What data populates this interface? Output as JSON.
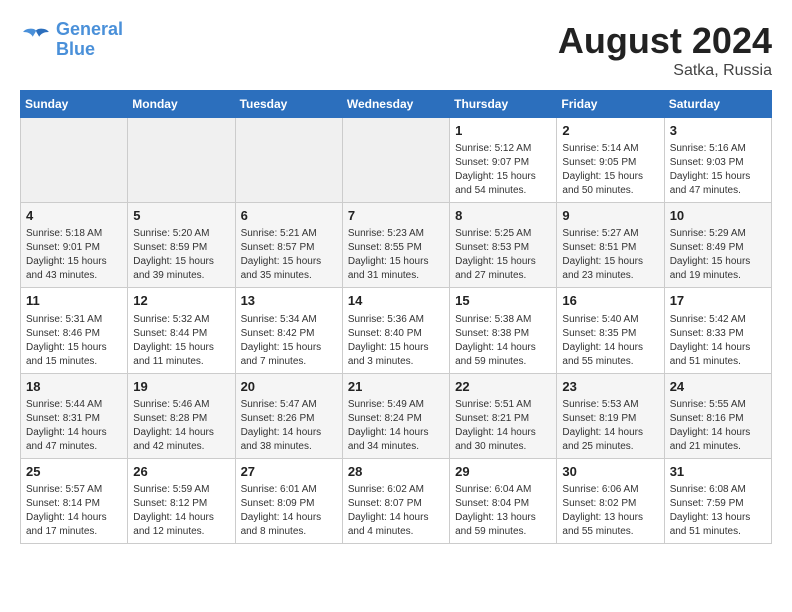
{
  "header": {
    "logo_line1": "General",
    "logo_line2": "Blue",
    "month_year": "August 2024",
    "location": "Satka, Russia"
  },
  "weekdays": [
    "Sunday",
    "Monday",
    "Tuesday",
    "Wednesday",
    "Thursday",
    "Friday",
    "Saturday"
  ],
  "weeks": [
    [
      {
        "day": "",
        "info": ""
      },
      {
        "day": "",
        "info": ""
      },
      {
        "day": "",
        "info": ""
      },
      {
        "day": "",
        "info": ""
      },
      {
        "day": "1",
        "info": "Sunrise: 5:12 AM\nSunset: 9:07 PM\nDaylight: 15 hours\nand 54 minutes."
      },
      {
        "day": "2",
        "info": "Sunrise: 5:14 AM\nSunset: 9:05 PM\nDaylight: 15 hours\nand 50 minutes."
      },
      {
        "day": "3",
        "info": "Sunrise: 5:16 AM\nSunset: 9:03 PM\nDaylight: 15 hours\nand 47 minutes."
      }
    ],
    [
      {
        "day": "4",
        "info": "Sunrise: 5:18 AM\nSunset: 9:01 PM\nDaylight: 15 hours\nand 43 minutes."
      },
      {
        "day": "5",
        "info": "Sunrise: 5:20 AM\nSunset: 8:59 PM\nDaylight: 15 hours\nand 39 minutes."
      },
      {
        "day": "6",
        "info": "Sunrise: 5:21 AM\nSunset: 8:57 PM\nDaylight: 15 hours\nand 35 minutes."
      },
      {
        "day": "7",
        "info": "Sunrise: 5:23 AM\nSunset: 8:55 PM\nDaylight: 15 hours\nand 31 minutes."
      },
      {
        "day": "8",
        "info": "Sunrise: 5:25 AM\nSunset: 8:53 PM\nDaylight: 15 hours\nand 27 minutes."
      },
      {
        "day": "9",
        "info": "Sunrise: 5:27 AM\nSunset: 8:51 PM\nDaylight: 15 hours\nand 23 minutes."
      },
      {
        "day": "10",
        "info": "Sunrise: 5:29 AM\nSunset: 8:49 PM\nDaylight: 15 hours\nand 19 minutes."
      }
    ],
    [
      {
        "day": "11",
        "info": "Sunrise: 5:31 AM\nSunset: 8:46 PM\nDaylight: 15 hours\nand 15 minutes."
      },
      {
        "day": "12",
        "info": "Sunrise: 5:32 AM\nSunset: 8:44 PM\nDaylight: 15 hours\nand 11 minutes."
      },
      {
        "day": "13",
        "info": "Sunrise: 5:34 AM\nSunset: 8:42 PM\nDaylight: 15 hours\nand 7 minutes."
      },
      {
        "day": "14",
        "info": "Sunrise: 5:36 AM\nSunset: 8:40 PM\nDaylight: 15 hours\nand 3 minutes."
      },
      {
        "day": "15",
        "info": "Sunrise: 5:38 AM\nSunset: 8:38 PM\nDaylight: 14 hours\nand 59 minutes."
      },
      {
        "day": "16",
        "info": "Sunrise: 5:40 AM\nSunset: 8:35 PM\nDaylight: 14 hours\nand 55 minutes."
      },
      {
        "day": "17",
        "info": "Sunrise: 5:42 AM\nSunset: 8:33 PM\nDaylight: 14 hours\nand 51 minutes."
      }
    ],
    [
      {
        "day": "18",
        "info": "Sunrise: 5:44 AM\nSunset: 8:31 PM\nDaylight: 14 hours\nand 47 minutes."
      },
      {
        "day": "19",
        "info": "Sunrise: 5:46 AM\nSunset: 8:28 PM\nDaylight: 14 hours\nand 42 minutes."
      },
      {
        "day": "20",
        "info": "Sunrise: 5:47 AM\nSunset: 8:26 PM\nDaylight: 14 hours\nand 38 minutes."
      },
      {
        "day": "21",
        "info": "Sunrise: 5:49 AM\nSunset: 8:24 PM\nDaylight: 14 hours\nand 34 minutes."
      },
      {
        "day": "22",
        "info": "Sunrise: 5:51 AM\nSunset: 8:21 PM\nDaylight: 14 hours\nand 30 minutes."
      },
      {
        "day": "23",
        "info": "Sunrise: 5:53 AM\nSunset: 8:19 PM\nDaylight: 14 hours\nand 25 minutes."
      },
      {
        "day": "24",
        "info": "Sunrise: 5:55 AM\nSunset: 8:16 PM\nDaylight: 14 hours\nand 21 minutes."
      }
    ],
    [
      {
        "day": "25",
        "info": "Sunrise: 5:57 AM\nSunset: 8:14 PM\nDaylight: 14 hours\nand 17 minutes."
      },
      {
        "day": "26",
        "info": "Sunrise: 5:59 AM\nSunset: 8:12 PM\nDaylight: 14 hours\nand 12 minutes."
      },
      {
        "day": "27",
        "info": "Sunrise: 6:01 AM\nSunset: 8:09 PM\nDaylight: 14 hours\nand 8 minutes."
      },
      {
        "day": "28",
        "info": "Sunrise: 6:02 AM\nSunset: 8:07 PM\nDaylight: 14 hours\nand 4 minutes."
      },
      {
        "day": "29",
        "info": "Sunrise: 6:04 AM\nSunset: 8:04 PM\nDaylight: 13 hours\nand 59 minutes."
      },
      {
        "day": "30",
        "info": "Sunrise: 6:06 AM\nSunset: 8:02 PM\nDaylight: 13 hours\nand 55 minutes."
      },
      {
        "day": "31",
        "info": "Sunrise: 6:08 AM\nSunset: 7:59 PM\nDaylight: 13 hours\nand 51 minutes."
      }
    ]
  ]
}
